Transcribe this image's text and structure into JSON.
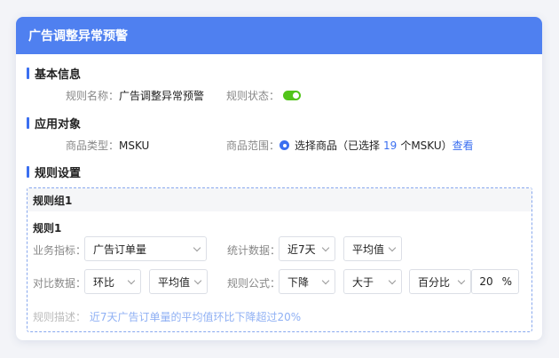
{
  "header": {
    "title": "广告调整异常预警"
  },
  "basic": {
    "title": "基本信息",
    "rule_name_label": "规则名称：",
    "rule_name_value": "广告调整异常预警",
    "rule_status_label": "规则状态："
  },
  "target": {
    "title": "应用对象",
    "product_type_label": "商品类型：",
    "product_type_value": "MSKU",
    "product_scope_label": "商品范围：",
    "scope_text_pre": "选择商品（已选择",
    "scope_count": "19",
    "scope_text_post": "个MSKU）",
    "view_link": "查看"
  },
  "rules": {
    "title": "规则设置",
    "group_title": "规则组1",
    "rule_title": "规则1",
    "metric_label": "业务指标：",
    "metric_value": "广告订单量",
    "stat_label": "统计数据：",
    "stat_period": "近7天",
    "stat_method": "平均值",
    "compare_label": "对比数据：",
    "compare_type": "环比",
    "compare_method": "平均值",
    "formula_label": "规则公式：",
    "formula_direction": "下降",
    "formula_operator": "大于",
    "formula_unit": "百分比",
    "formula_value": "20",
    "formula_suffix": "%",
    "desc_label": "规则描述：",
    "desc_value": "近7天广告订单量的平均值环比下降超过20%"
  },
  "colors": {
    "accent": "#4f80f0",
    "toggle_on": "#52c41a"
  }
}
